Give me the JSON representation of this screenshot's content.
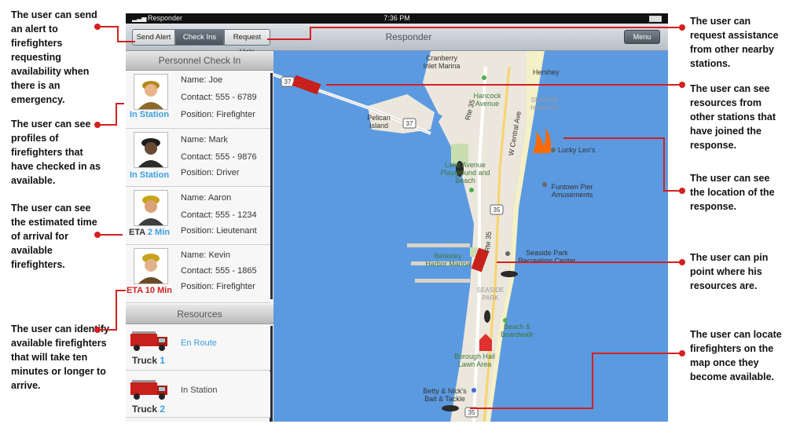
{
  "annotations": {
    "left": [
      "The user can send an alert to firefighters requesting availability when there is an emergency.",
      "The user can see profiles of firefighters that have checked in as available.",
      "The user can see the estimated time of arrival for available firefighters.",
      "The user can identify available firefighters that will take ten minutes or longer to arrive."
    ],
    "right": [
      "The user can request assistance from other nearby stations.",
      "The user can see resources from other stations that have joined the response.",
      "The user can see the location of the response.",
      "The user can pin point where his resources are.",
      "The user can locate firefighters on the map once they become available."
    ]
  },
  "statusbar": {
    "carrier": "Responder",
    "time": "7:36 PM"
  },
  "navbar": {
    "tabs": [
      "Send Alert",
      "Check Ins",
      "Request Help"
    ],
    "active_tab": "Check Ins",
    "title": "Responder",
    "menu": "Menu"
  },
  "personnel": {
    "header": "Personnel Check In",
    "people": [
      {
        "name": "Name: Joe",
        "contact": "Contact: 555 - 6789",
        "position": "Position: Firefighter",
        "status_prefix": "In Station",
        "status_value": "",
        "status_color": "#3aa0e0"
      },
      {
        "name": "Name: Mark",
        "contact": "Contact: 555 - 9876",
        "position": "Position: Driver",
        "status_prefix": "In Station",
        "status_value": "",
        "status_color": "#3aa0e0"
      },
      {
        "name": "Name: Aaron",
        "contact": "Contact: 555 - 1234",
        "position": "Position: Lieutenant",
        "status_prefix": "ETA",
        "status_value": "2 Min",
        "status_color": "#3aa0e0"
      },
      {
        "name": "Name: Kevin",
        "contact": "Contact: 555 - 1865",
        "position": "Position: Firefighter",
        "status_prefix": "ETA",
        "status_value": "10 Min",
        "status_color": "#d22222"
      }
    ]
  },
  "resources": {
    "header": "Resources",
    "trucks": [
      {
        "label": "Truck",
        "number": "1",
        "status": "En Route",
        "status_color": "#3aa0e0"
      },
      {
        "label": "Truck",
        "number": "2",
        "status": "In Station",
        "status_color": "#444444"
      }
    ]
  },
  "map": {
    "labels": {
      "cranberry": "Cranberry Inlet Marina",
      "hershey": "Hershey",
      "hancock": "Hancock Avenue",
      "seaside_heights": "SEASIDE HEIGHTS",
      "pelican": "Pelican Island",
      "central": "W Central Ave",
      "rte35a": "Rte 35",
      "rte35b": "Rte 35",
      "lucky": "Lucky Leo's",
      "lake": "Lake Avenue Playground and Beach",
      "funtown": "Funtown Pier Amusements",
      "seaside_park": "Seaside Park Recreation Center",
      "berkeley": "Berkeley Harbor Marina",
      "seaside": "SEASIDE PARK",
      "beach": "Beach & Boardwalk",
      "borough": "Borough Hall Lawn Area",
      "betty": "Betty & Nick's Bait & Tackle"
    },
    "shields": [
      "37",
      "37",
      "35",
      "35"
    ],
    "colors": {
      "water": "#5b9ae0",
      "land": "#ece7dc",
      "fire": "#ff6a00",
      "accent_line": "#d42020"
    }
  }
}
